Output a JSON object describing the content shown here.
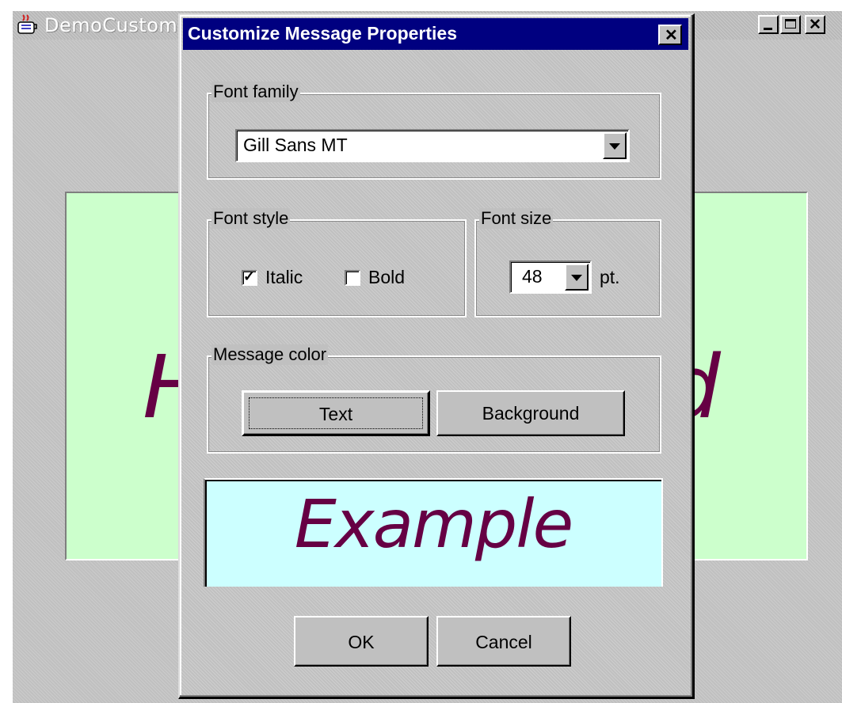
{
  "parent_window": {
    "title": "DemoCustom",
    "icon": "java-coffee-cup-icon",
    "controls": [
      "minimize-icon",
      "maximize-icon",
      "close-icon"
    ],
    "canvas": {
      "background": "#ccffcc",
      "text_color": "#660044",
      "visible_left_letter": "H",
      "visible_right_letter": "d"
    }
  },
  "dialog": {
    "title": "Customize Message Properties",
    "title_bar_color": "#000080",
    "font_family": {
      "legend": "Font family",
      "selected": "Gill Sans MT"
    },
    "font_style": {
      "legend": "Font style",
      "italic": {
        "label": "Italic",
        "checked": true
      },
      "bold": {
        "label": "Bold",
        "checked": false
      }
    },
    "font_size": {
      "legend": "Font size",
      "selected": "48",
      "unit": "pt."
    },
    "message_color": {
      "legend": "Message color",
      "text_button": "Text",
      "background_button": "Background"
    },
    "preview": {
      "text": "Example",
      "background": "#ccffff",
      "text_color": "#660044"
    },
    "ok_button": "OK",
    "cancel_button": "Cancel"
  }
}
